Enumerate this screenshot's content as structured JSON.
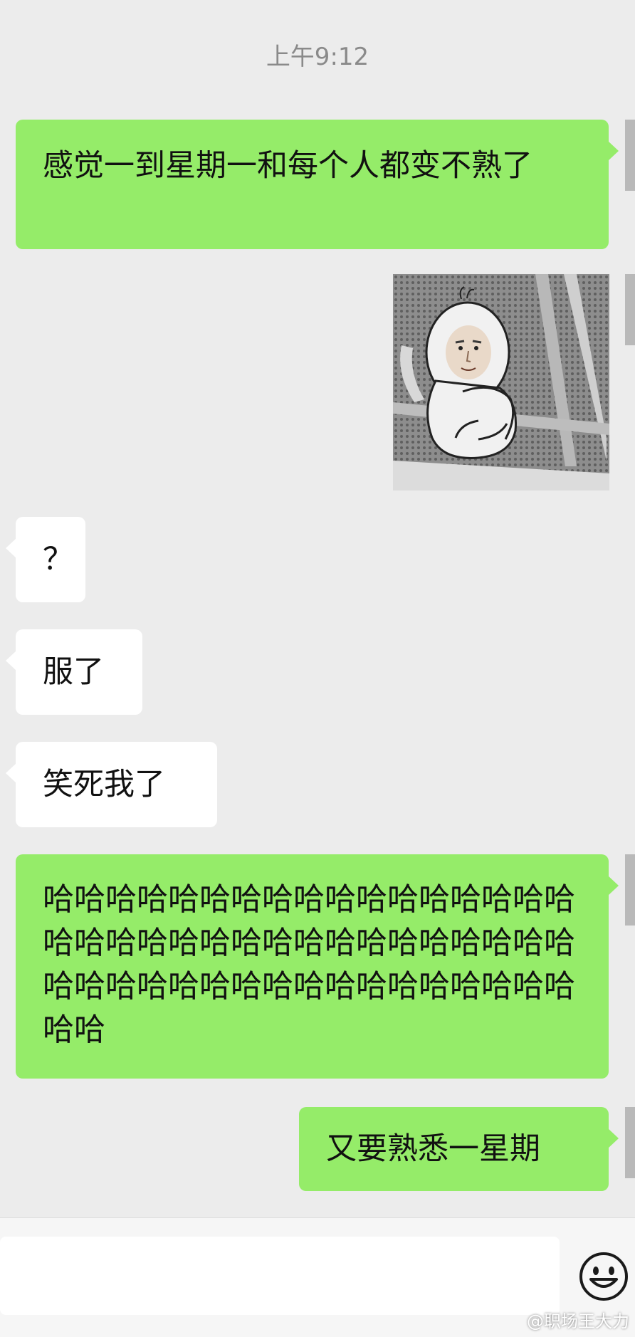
{
  "chat": {
    "timestamp": "上午9:12",
    "messages": [
      {
        "side": "me",
        "type": "text",
        "text": "感觉一到星期一和每个人都变不熟了"
      },
      {
        "side": "me",
        "type": "sticker",
        "sticker": "sad-bald-character-hugging-knees-on-bench"
      },
      {
        "side": "them",
        "type": "text",
        "text": "？"
      },
      {
        "side": "them",
        "type": "text",
        "text": "服了"
      },
      {
        "side": "them",
        "type": "text",
        "text": "笑死我了"
      },
      {
        "side": "me",
        "type": "text",
        "text": "哈哈哈哈哈哈哈哈哈哈哈哈哈哈哈哈哈哈哈哈哈哈哈哈哈哈哈哈哈哈哈哈哈哈哈哈哈哈哈哈哈哈哈哈哈哈哈哈哈哈哈哈哈"
      },
      {
        "side": "me",
        "type": "text",
        "text": "又要熟悉一星期"
      }
    ]
  },
  "input_bar": {
    "value": "",
    "emoji_icon": "smiley-face-icon"
  },
  "watermark": "@职场王大力",
  "colors": {
    "background": "#ececec",
    "my_bubble": "#95ec69",
    "their_bubble": "#ffffff"
  }
}
